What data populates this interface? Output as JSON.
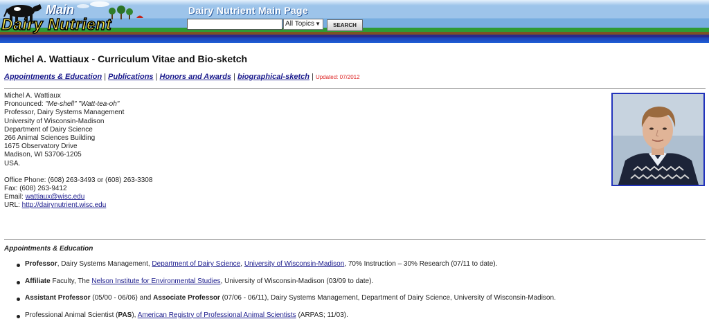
{
  "header": {
    "logo_top": "Main",
    "logo_name": "Dairy Nutrient",
    "page_heading": "Dairy Nutrient Main Page",
    "search_value": "",
    "topic_selected": "All Topics",
    "search_button": "SEARCH"
  },
  "page_title": "Michel A. Wattiaux - Curriculum Vitae and Bio-sketch",
  "nav": {
    "links": [
      "Appointments & Education",
      "Publications",
      "Honors and Awards",
      "biographical-sketch"
    ],
    "separator": "|",
    "updated": "Updated: 07/2012"
  },
  "contact": {
    "name": "Michel A. Wattiaux",
    "pronounced_label": "Pronounced: ",
    "pronounced_value": "\"Me-shell\" \"Watt-tea-oh\"",
    "title": "Professor, Dairy Systems Management",
    "university": "University of Wisconsin-Madison",
    "department": "Department of Dairy Science",
    "building": "266 Animal Sciences Building",
    "street": "1675 Observatory Drive",
    "city": "Madison, WI 53706-1205",
    "country": "USA.",
    "phone": "Office Phone: (608) 263-3493 or (608) 263-3308",
    "fax": "Fax: (608) 263-9412",
    "email_label": "Email: ",
    "email": "wattiaux@wisc.edu",
    "url_label": "URL: ",
    "url": "http://dairynutrient.wisc.edu"
  },
  "section_title": "Appointments & Education",
  "appointments": [
    {
      "bold": "Professor",
      "text1": ", Dairy Systems Management, ",
      "link1": "Department of Dairy Science",
      "text2": ", ",
      "link2": "University of Wisconsin-Madison",
      "text3": ", 70% Instruction – 30% Research (07/11 to date)."
    },
    {
      "bold": "Affiliate",
      "text1": " Faculty, The ",
      "link1": "Nelson Institute for Environmental Studies",
      "text2": ", University of Wisconsin-Madison (03/09 to date)."
    },
    {
      "bold": "Assistant Professor",
      "text1": " (05/00 - 06/06) and ",
      "bold2": "Associate Professor",
      "text2": " (07/06 - 06/11), Dairy Systems Management, Department of Dairy Science, University of Wisconsin-Madison."
    },
    {
      "text0": "Professional Animal Scientist (",
      "bold": "PAS",
      "text1": "), ",
      "link1": "American Registry of Professional Animal Scientists",
      "text2": " (ARPAS; 11/03)."
    }
  ]
}
